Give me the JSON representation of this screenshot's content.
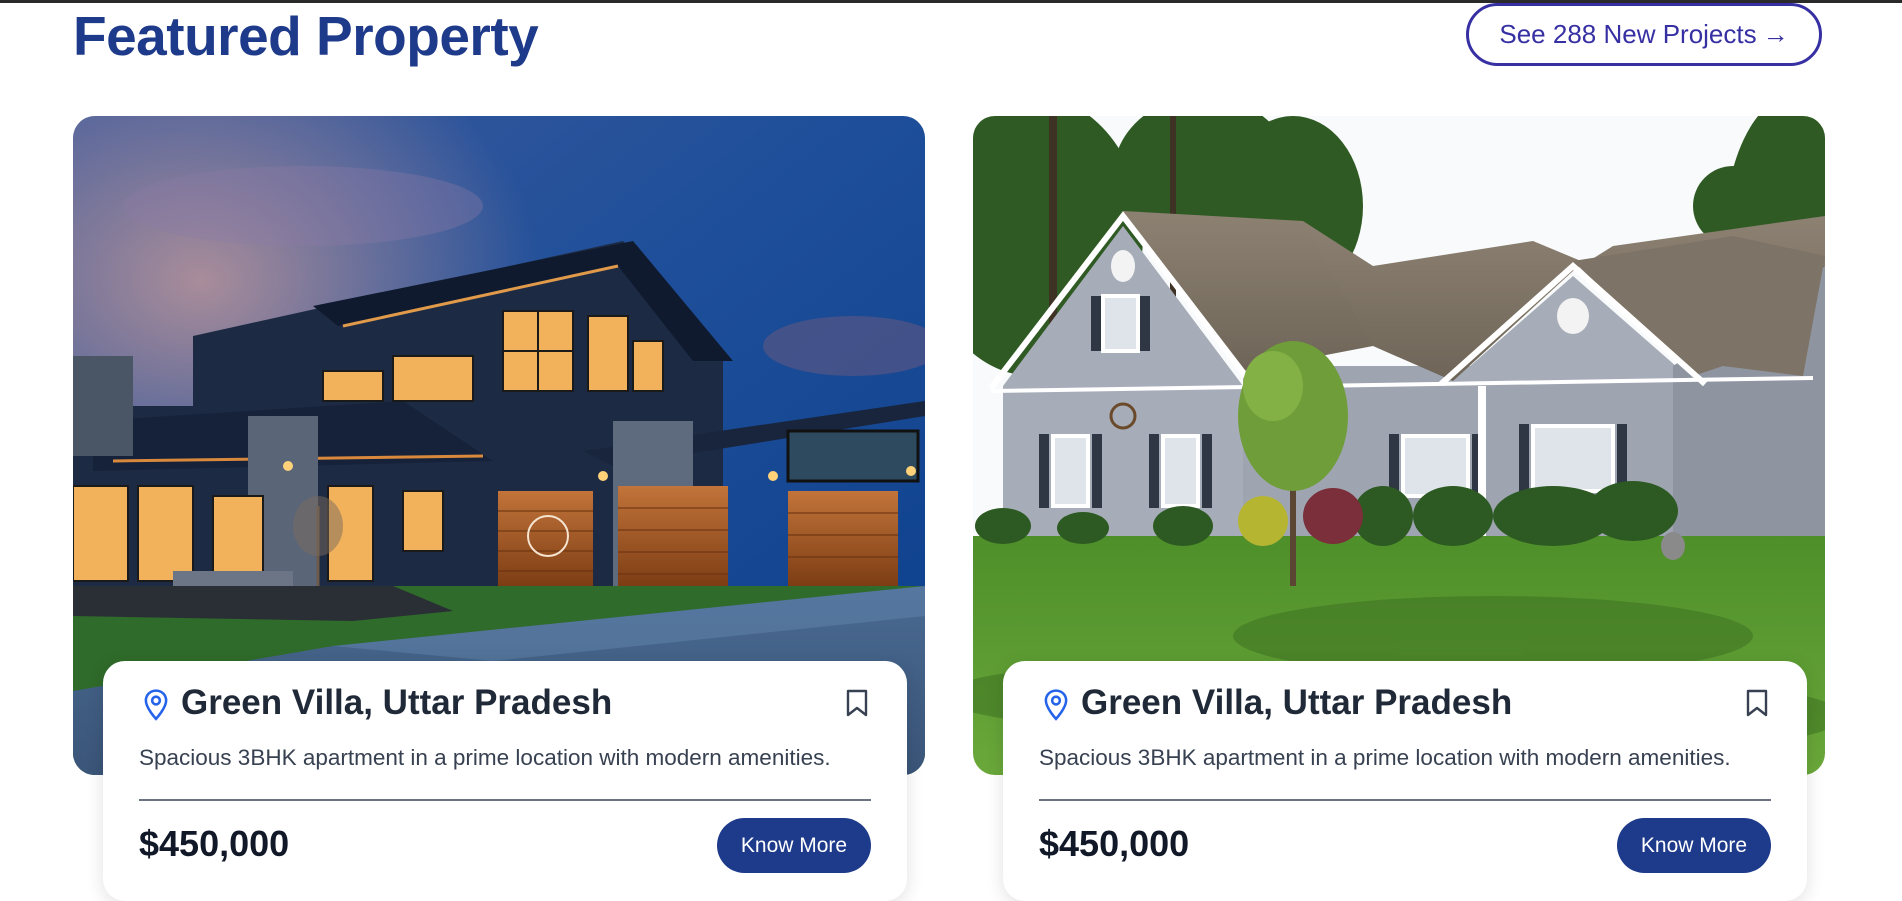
{
  "header": {
    "title": "Featured Property",
    "see_projects_label": "See 288 New Projects",
    "see_projects_arrow": "→"
  },
  "cards": [
    {
      "title": "Green Villa, Uttar Pradesh",
      "description": "Spacious 3BHK apartment in a prime location with modern amenities.",
      "price": "$450,000",
      "button_label": "Know More",
      "image_icon": "modern-dusk-villa-photo"
    },
    {
      "title": "Green Villa, Uttar Pradesh",
      "description": "Spacious 3BHK apartment in a prime location with modern amenities.",
      "price": "$450,000",
      "button_label": "Know More",
      "image_icon": "suburban-grey-house-photo"
    }
  ],
  "colors": {
    "heading": "#1e3a8a",
    "outline_button": "#3730a3",
    "primary_button": "#1e3a8a",
    "location_pin": "#2563eb"
  }
}
